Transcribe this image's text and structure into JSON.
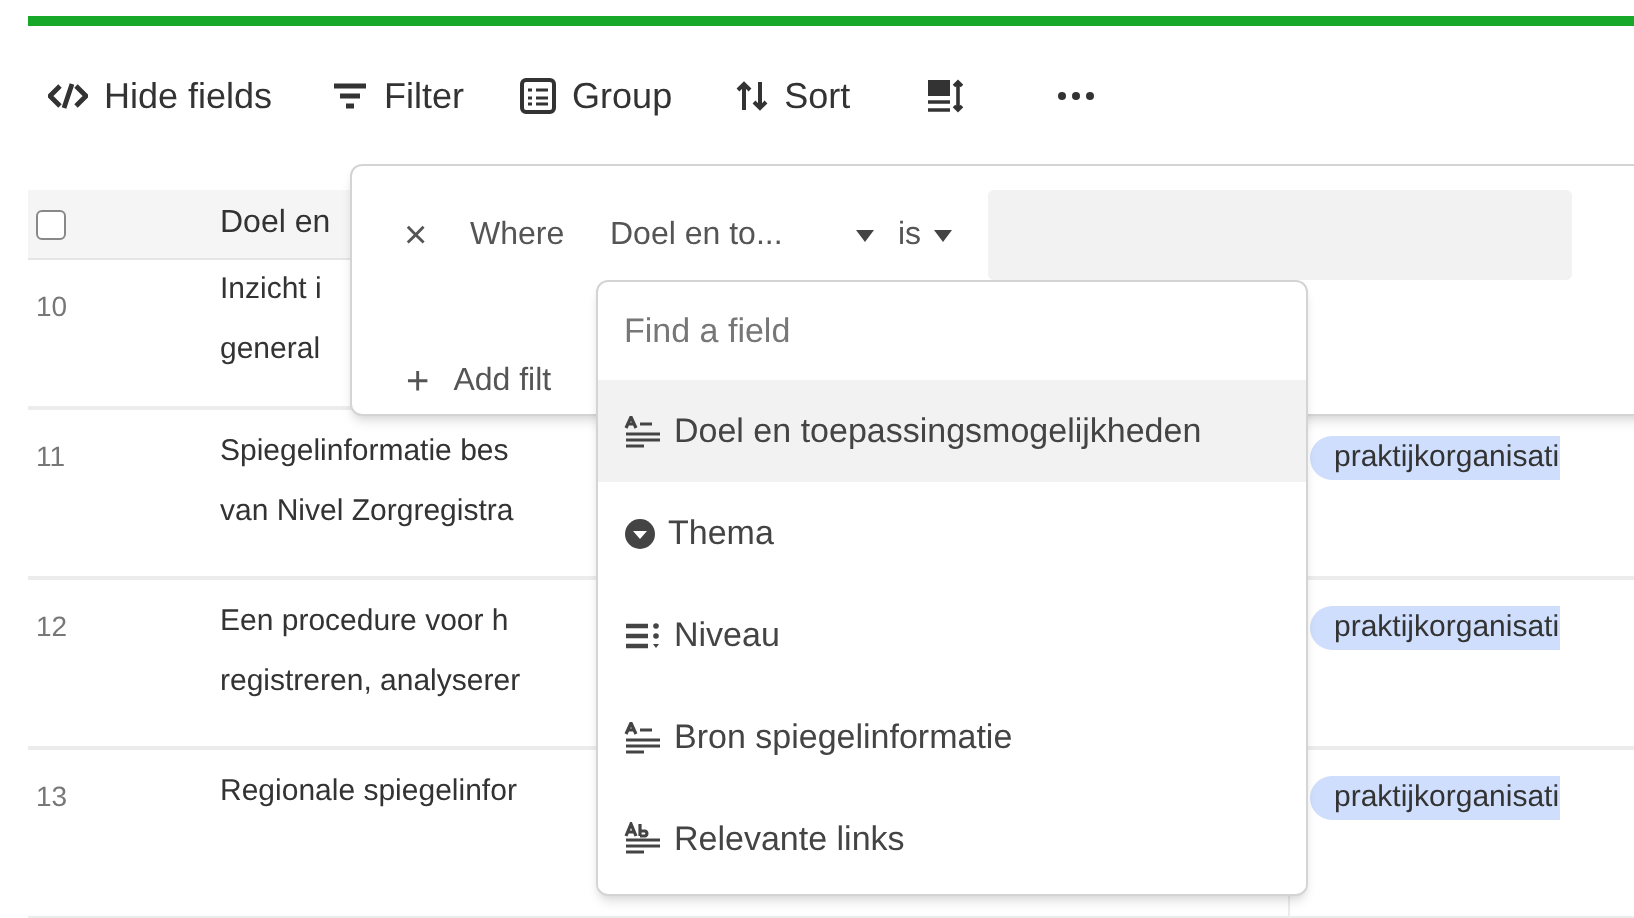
{
  "progress": {
    "level": 1
  },
  "toolbar": [
    {
      "kind": "hide",
      "label": "Hide fields"
    },
    {
      "kind": "filter",
      "label": "Filter"
    },
    {
      "kind": "group",
      "label": "Group"
    },
    {
      "kind": "sort",
      "label": "Sort"
    },
    {
      "kind": "height"
    },
    {
      "kind": "more"
    }
  ],
  "table": {
    "header": {
      "checked": false,
      "column_2": "Doel en"
    },
    "rows": [
      {
        "number": "10",
        "lines": [
          "Inzicht i",
          "general"
        ]
      },
      {
        "number": "11",
        "lines": [
          "Spiegelinformatie bes",
          "van Nivel Zorgregistra"
        ],
        "tag": "praktijkorganisati"
      },
      {
        "number": "12",
        "lines": [
          "Een procedure voor h",
          "registreren, analyserer"
        ],
        "tag": "praktijkorganisati"
      },
      {
        "number": "13",
        "lines": [
          "Regionale spiegelinfor"
        ],
        "tag": "praktijkorganisati"
      }
    ]
  },
  "filter_panel": {
    "remove": "×",
    "where": "Where",
    "field": "Doel en to...",
    "operator": "is",
    "add": "+",
    "add_label": "Add filt"
  },
  "field_menu": {
    "placeholder": "Find a field",
    "items": [
      {
        "kind": "text",
        "label": "Doel en toepassingsmogelijkheden",
        "selected": true
      },
      {
        "kind": "select",
        "label": "Thema",
        "selected": false
      },
      {
        "kind": "list",
        "label": "Niveau",
        "selected": false
      },
      {
        "kind": "text",
        "label": "Bron spiegelinformatie",
        "selected": false
      },
      {
        "kind": "rich",
        "label": "Relevante links",
        "selected": false
      }
    ]
  }
}
